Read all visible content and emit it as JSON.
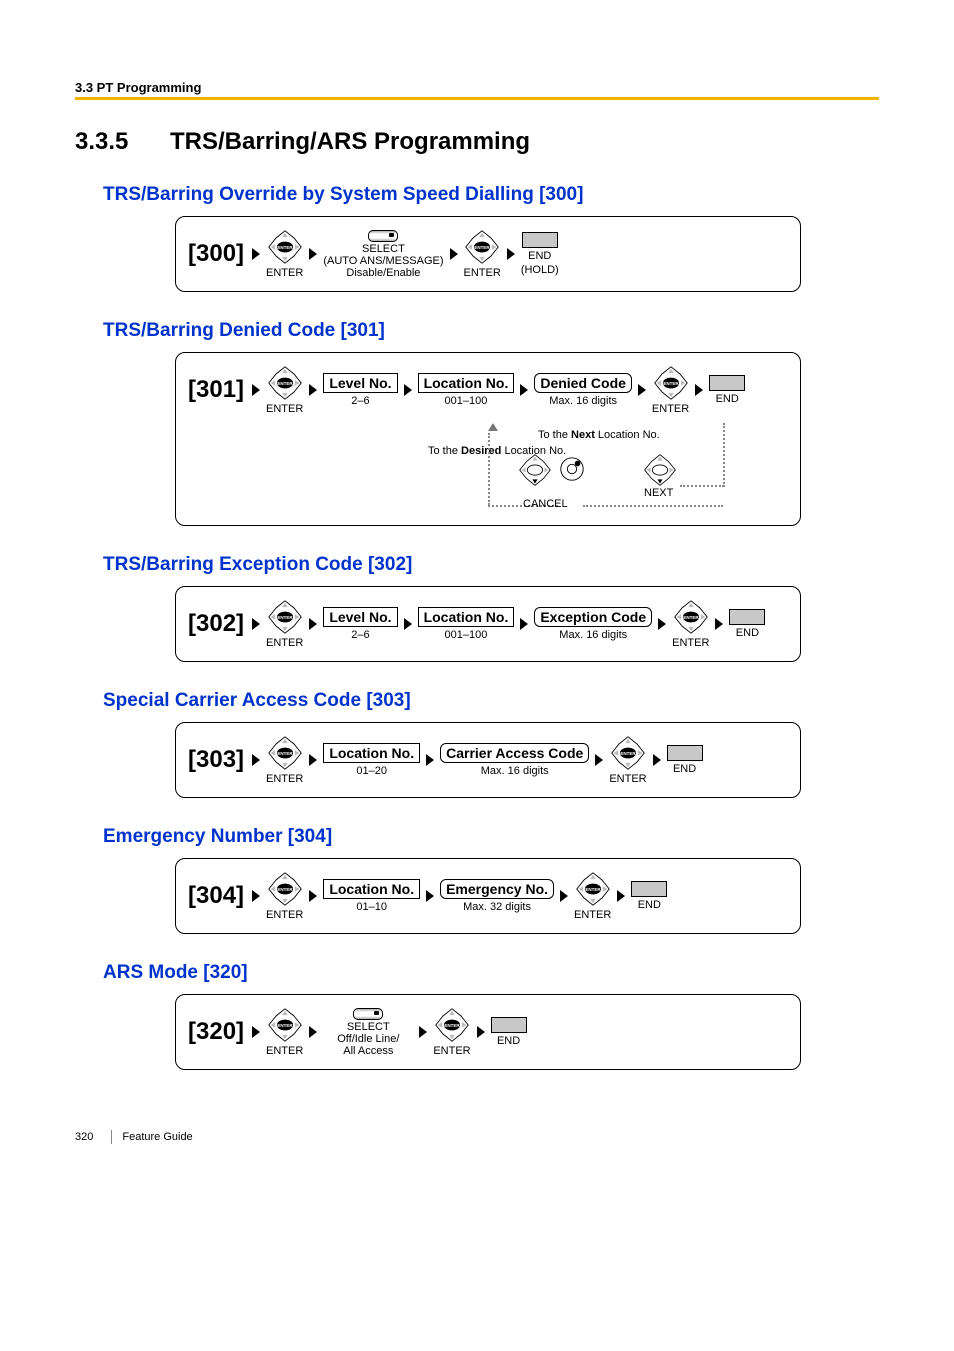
{
  "header": {
    "running": "3.3 PT Programming"
  },
  "section": {
    "num": "3.3.5",
    "title": "TRS/Barring/ARS Programming"
  },
  "subs": [
    {
      "title": "TRS/Barring Override by System Speed Dialling [300]",
      "code": "[300]",
      "steps": [
        {
          "type": "enter",
          "sub": "ENTER"
        },
        {
          "type": "select",
          "top": "SELECT",
          "mid": "(AUTO ANS/MESSAGE)",
          "sub": "Disable/Enable"
        },
        {
          "type": "enter",
          "sub": "ENTER"
        },
        {
          "type": "end",
          "sub1": "END",
          "sub2": "(HOLD)"
        }
      ]
    },
    {
      "title": "TRS/Barring Denied Code [301]",
      "code": "[301]",
      "loop": true,
      "steps": [
        {
          "type": "enter",
          "sub": "ENTER"
        },
        {
          "type": "box",
          "label": "Level No.",
          "sub": "2–6"
        },
        {
          "type": "box",
          "label": "Location No.",
          "sub": "001–100"
        },
        {
          "type": "roundbox",
          "label": "Denied Code",
          "sub": "Max. 16 digits"
        },
        {
          "type": "enter",
          "sub": "ENTER"
        },
        {
          "type": "end",
          "sub1": "END"
        }
      ],
      "loop_labels": {
        "next": "To the Next Location No.",
        "desired": "To the Desired Location No.",
        "cancel": "CANCEL",
        "nextbtn": "NEXT"
      }
    },
    {
      "title": "TRS/Barring Exception Code [302]",
      "code": "[302]",
      "steps": [
        {
          "type": "enter",
          "sub": "ENTER"
        },
        {
          "type": "box",
          "label": "Level No.",
          "sub": "2–6"
        },
        {
          "type": "box",
          "label": "Location No.",
          "sub": "001–100"
        },
        {
          "type": "roundbox",
          "label": "Exception Code",
          "sub": "Max. 16 digits"
        },
        {
          "type": "enter",
          "sub": "ENTER"
        },
        {
          "type": "end",
          "sub1": "END"
        }
      ]
    },
    {
      "title": "Special Carrier Access Code [303]",
      "code": "[303]",
      "steps": [
        {
          "type": "enter",
          "sub": "ENTER"
        },
        {
          "type": "box",
          "label": "Location No.",
          "sub": "01–20"
        },
        {
          "type": "roundbox",
          "label": "Carrier Access Code",
          "sub": "Max. 16 digits"
        },
        {
          "type": "enter",
          "sub": "ENTER"
        },
        {
          "type": "end",
          "sub1": "END"
        }
      ]
    },
    {
      "title": "Emergency Number [304]",
      "code": "[304]",
      "steps": [
        {
          "type": "enter",
          "sub": "ENTER"
        },
        {
          "type": "box",
          "label": "Location No.",
          "sub": "01–10"
        },
        {
          "type": "roundbox",
          "label": "Emergency No.",
          "sub": "Max. 32 digits"
        },
        {
          "type": "enter",
          "sub": "ENTER"
        },
        {
          "type": "end",
          "sub1": "END"
        }
      ]
    },
    {
      "title": "ARS Mode [320]",
      "code": "[320]",
      "steps": [
        {
          "type": "enter",
          "sub": "ENTER"
        },
        {
          "type": "select",
          "top": "SELECT",
          "mid": "Off/Idle Line/",
          "sub": "All Access"
        },
        {
          "type": "enter",
          "sub": "ENTER"
        },
        {
          "type": "end",
          "sub1": "END"
        }
      ]
    }
  ],
  "footer": {
    "page": "320",
    "guide": "Feature Guide"
  }
}
